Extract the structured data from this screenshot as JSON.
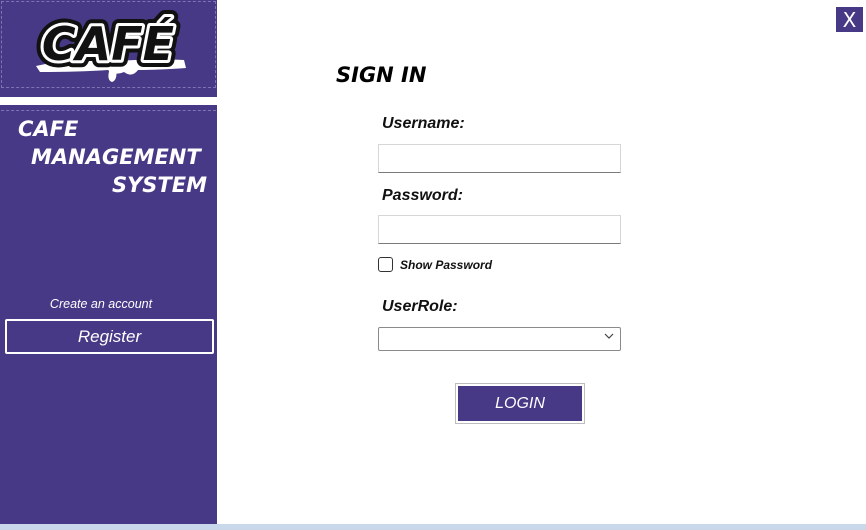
{
  "sidebar": {
    "logo_text": "CAFÉ",
    "title_lines": [
      "CAFE",
      "MANAGEMENT",
      "SYSTEM"
    ],
    "create_account_label": "Create an account",
    "register_label": "Register"
  },
  "window": {
    "close_label": "X"
  },
  "form": {
    "heading": "SIGN IN",
    "username_label": "Username:",
    "username_value": "",
    "password_label": "Password:",
    "password_value": "",
    "show_password_label": "Show Password",
    "show_password_checked": false,
    "userrole_label": "UserRole:",
    "userrole_selected": "",
    "login_label": "LOGIN"
  },
  "colors": {
    "accent": "#473985",
    "background": "#ffffff",
    "bottom_strip": "#c9d8ea"
  }
}
